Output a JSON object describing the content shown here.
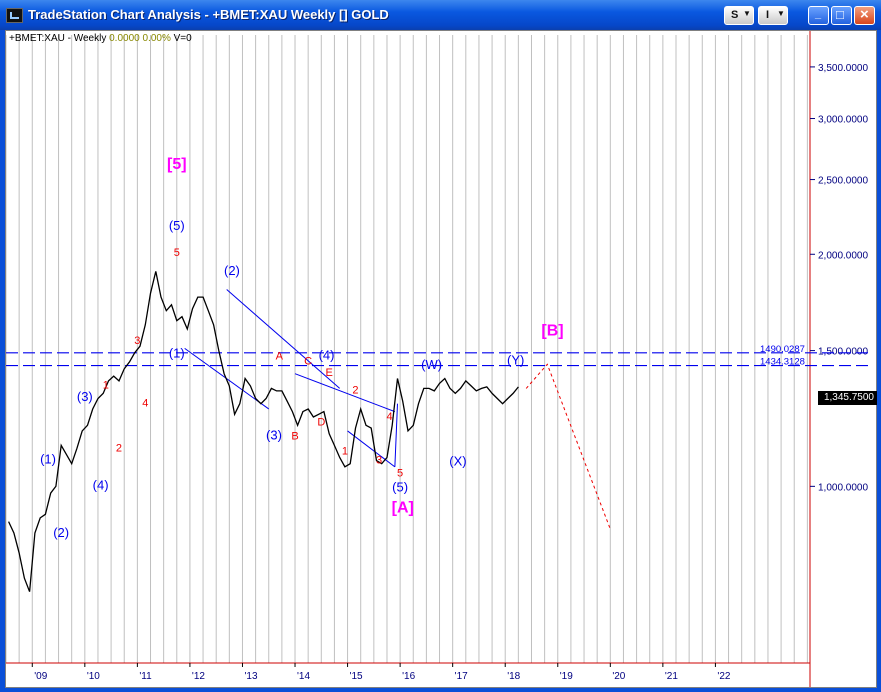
{
  "window": {
    "title": "TradeStation Chart Analysis - +BMET:XAU Weekly [] GOLD",
    "buttons": {
      "s_label": "S",
      "i_label": "I",
      "minimize": "_",
      "maximize": "□",
      "close": "×"
    }
  },
  "header": {
    "symbol": "+BMET:XAU - Weekly",
    "change": "0.0000",
    "change_pct": "0.00%",
    "volume": "V=0"
  },
  "colors": {
    "price": "#000000",
    "wave_primary": "#0000ee",
    "wave_minor": "#ee0000",
    "wave_major": "#ff00ff",
    "axis_text": "#000080",
    "right_axis_line": "#cc0000",
    "grid": "#c0c0c0"
  },
  "chart_data": {
    "type": "line",
    "title": "+BMET:XAU Weekly [] GOLD",
    "y_scale": "log",
    "ylim": [
      590,
      3850
    ],
    "xlim": [
      2008.5,
      2023.8
    ],
    "grid": true,
    "x_ticks": [
      "'09",
      "'10",
      "'11",
      "'12",
      "'13",
      "'14",
      "'15",
      "'16",
      "'17",
      "'18",
      "'19",
      "'20",
      "'21",
      "'22"
    ],
    "x_tick_years": [
      2009,
      2010,
      2011,
      2012,
      2013,
      2014,
      2015,
      2016,
      2017,
      2018,
      2019,
      2020,
      2021,
      2022
    ],
    "y_ticks": [
      "3,500.0000",
      "3,000.0000",
      "2,500.0000",
      "2,000.0000",
      "1,500.0000",
      "1,000.0000"
    ],
    "y_tick_values": [
      3500,
      3000,
      2500,
      2000,
      1500,
      1000
    ],
    "last_price": "1,345.7500",
    "last_price_value": 1345.75,
    "series": [
      {
        "x": [
          2008.55,
          2008.65,
          2008.75,
          2008.85,
          2008.95,
          2009.05,
          2009.15,
          2009.25,
          2009.35,
          2009.45,
          2009.55,
          2009.65,
          2009.75,
          2009.85,
          2009.95,
          2010.05,
          2010.15,
          2010.25,
          2010.35,
          2010.45,
          2010.55,
          2010.65,
          2010.75,
          2010.85,
          2010.95,
          2011.05,
          2011.15,
          2011.25,
          2011.35,
          2011.45,
          2011.55,
          2011.65,
          2011.75,
          2011.85,
          2011.95,
          2012.05,
          2012.15,
          2012.25,
          2012.35,
          2012.45,
          2012.55,
          2012.65,
          2012.75,
          2012.85,
          2012.95,
          2013.05,
          2013.15,
          2013.25,
          2013.35,
          2013.45,
          2013.55,
          2013.65,
          2013.75,
          2013.85,
          2013.95,
          2014.05,
          2014.15,
          2014.25,
          2014.35,
          2014.45,
          2014.55,
          2014.65,
          2014.75,
          2014.85,
          2014.95,
          2015.05,
          2015.15,
          2015.25,
          2015.35,
          2015.45,
          2015.55,
          2015.65,
          2015.75,
          2015.85,
          2015.95,
          2016.05,
          2016.15,
          2016.25,
          2016.35,
          2016.45,
          2016.55,
          2016.65,
          2016.75,
          2016.85,
          2016.95,
          2017.05,
          2017.15,
          2017.25,
          2017.35,
          2017.45,
          2017.55,
          2017.65,
          2017.75,
          2017.85,
          2017.95,
          2018.05,
          2018.15,
          2018.25
        ],
        "y": [
          900,
          870,
          820,
          760,
          730,
          870,
          910,
          920,
          980,
          1000,
          1130,
          1100,
          1070,
          1120,
          1180,
          1200,
          1260,
          1300,
          1320,
          1370,
          1390,
          1370,
          1420,
          1450,
          1490,
          1520,
          1620,
          1780,
          1900,
          1760,
          1690,
          1720,
          1640,
          1660,
          1600,
          1700,
          1760,
          1760,
          1690,
          1620,
          1500,
          1400,
          1350,
          1240,
          1280,
          1380,
          1350,
          1300,
          1280,
          1300,
          1340,
          1330,
          1330,
          1290,
          1250,
          1200,
          1250,
          1260,
          1230,
          1240,
          1250,
          1170,
          1130,
          1090,
          1060,
          1070,
          1190,
          1260,
          1200,
          1190,
          1080,
          1070,
          1090,
          1200,
          1380,
          1290,
          1180,
          1200,
          1280,
          1340,
          1340,
          1330,
          1360,
          1380,
          1340,
          1320,
          1340,
          1370,
          1350,
          1330,
          1340,
          1345.75,
          1320,
          1300,
          1280,
          1300,
          1320,
          1345.75
        ]
      }
    ],
    "horizontal_levels": [
      {
        "label": "1490.0287",
        "value": 1490.0287
      },
      {
        "label": "1434.3128",
        "value": 1434.3128
      }
    ],
    "trend_lines": [
      {
        "from": [
          2011.9,
          1510
        ],
        "to": [
          2013.5,
          1260
        ]
      },
      {
        "from": [
          2012.7,
          1800
        ],
        "to": [
          2014.85,
          1340
        ]
      },
      {
        "from": [
          2014.0,
          1400
        ],
        "to": [
          2015.9,
          1250
        ]
      },
      {
        "from": [
          2015.0,
          1180
        ],
        "to": [
          2015.9,
          1060
        ]
      },
      {
        "from": [
          2015.9,
          1060
        ],
        "to": [
          2015.95,
          1280
        ]
      }
    ],
    "projection": [
      {
        "x": 2018.4,
        "y": 1340
      },
      {
        "x": 2018.8,
        "y": 1440
      },
      {
        "x": 2020.0,
        "y": 880
      }
    ],
    "annotations": [
      {
        "text": "[5]",
        "x": 2011.75,
        "y": 2580,
        "style": "major"
      },
      {
        "text": "(5)",
        "x": 2011.75,
        "y": 2150,
        "style": "primary"
      },
      {
        "text": "5",
        "x": 2011.75,
        "y": 1990,
        "style": "minor"
      },
      {
        "text": "3",
        "x": 2011.0,
        "y": 1530,
        "style": "minor"
      },
      {
        "text": "(1)",
        "x": 2011.75,
        "y": 1470,
        "style": "primary"
      },
      {
        "text": "4",
        "x": 2011.15,
        "y": 1270,
        "style": "minor"
      },
      {
        "text": "1",
        "x": 2010.4,
        "y": 1340,
        "style": "minor"
      },
      {
        "text": "(3)",
        "x": 2010.0,
        "y": 1290,
        "style": "primary"
      },
      {
        "text": "2",
        "x": 2010.65,
        "y": 1110,
        "style": "minor"
      },
      {
        "text": "(1)",
        "x": 2009.3,
        "y": 1070,
        "style": "primary"
      },
      {
        "text": "(4)",
        "x": 2010.3,
        "y": 990,
        "style": "primary"
      },
      {
        "text": "(2)",
        "x": 2009.55,
        "y": 860,
        "style": "primary"
      },
      {
        "text": "(2)",
        "x": 2012.8,
        "y": 1880,
        "style": "primary"
      },
      {
        "text": "A",
        "x": 2013.7,
        "y": 1460,
        "style": "minor"
      },
      {
        "text": "C",
        "x": 2014.25,
        "y": 1440,
        "style": "minor"
      },
      {
        "text": "(4)",
        "x": 2014.6,
        "y": 1460,
        "style": "primary"
      },
      {
        "text": "E",
        "x": 2014.65,
        "y": 1390,
        "style": "minor"
      },
      {
        "text": "D",
        "x": 2014.5,
        "y": 1200,
        "style": "minor"
      },
      {
        "text": "(3)",
        "x": 2013.6,
        "y": 1150,
        "style": "primary"
      },
      {
        "text": "B",
        "x": 2014.0,
        "y": 1150,
        "style": "minor"
      },
      {
        "text": "2",
        "x": 2015.15,
        "y": 1320,
        "style": "minor"
      },
      {
        "text": "1",
        "x": 2014.95,
        "y": 1100,
        "style": "minor"
      },
      {
        "text": "4",
        "x": 2015.8,
        "y": 1220,
        "style": "minor"
      },
      {
        "text": "3",
        "x": 2015.6,
        "y": 1070,
        "style": "minor"
      },
      {
        "text": "5",
        "x": 2016.0,
        "y": 1030,
        "style": "minor"
      },
      {
        "text": "(5)",
        "x": 2016.0,
        "y": 985,
        "style": "primary"
      },
      {
        "text": "[A]",
        "x": 2016.05,
        "y": 925,
        "style": "major"
      },
      {
        "text": "(W)",
        "x": 2016.6,
        "y": 1420,
        "style": "primary"
      },
      {
        "text": "(X)",
        "x": 2017.1,
        "y": 1065,
        "style": "primary"
      },
      {
        "text": "(Y)",
        "x": 2018.2,
        "y": 1440,
        "style": "primary"
      },
      {
        "text": "[B]",
        "x": 2018.9,
        "y": 1570,
        "style": "major"
      }
    ]
  }
}
